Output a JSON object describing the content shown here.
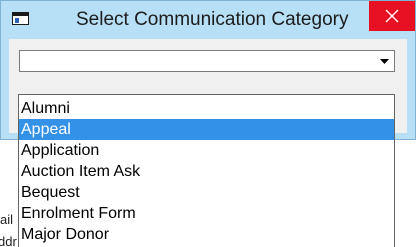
{
  "window": {
    "title": "Select Communication Category",
    "close_label": "×"
  },
  "combo": {
    "value": ""
  },
  "dropdown": {
    "selected_index": 1,
    "options": [
      {
        "label": "Alumni"
      },
      {
        "label": "Appeal"
      },
      {
        "label": "Application"
      },
      {
        "label": "Auction Item Ask"
      },
      {
        "label": "Bequest"
      },
      {
        "label": "Enrolment Form"
      },
      {
        "label": "Major Donor"
      }
    ]
  },
  "background_window": {
    "fragment_1": "ail",
    "fragment_2": "ddr"
  },
  "colors": {
    "titlebar": "#b7dff5",
    "close_button": "#e81123",
    "selection": "#3391e8"
  },
  "icons": {
    "app": "window-icon",
    "close": "close-icon",
    "dropdown": "chevron-down-icon"
  }
}
